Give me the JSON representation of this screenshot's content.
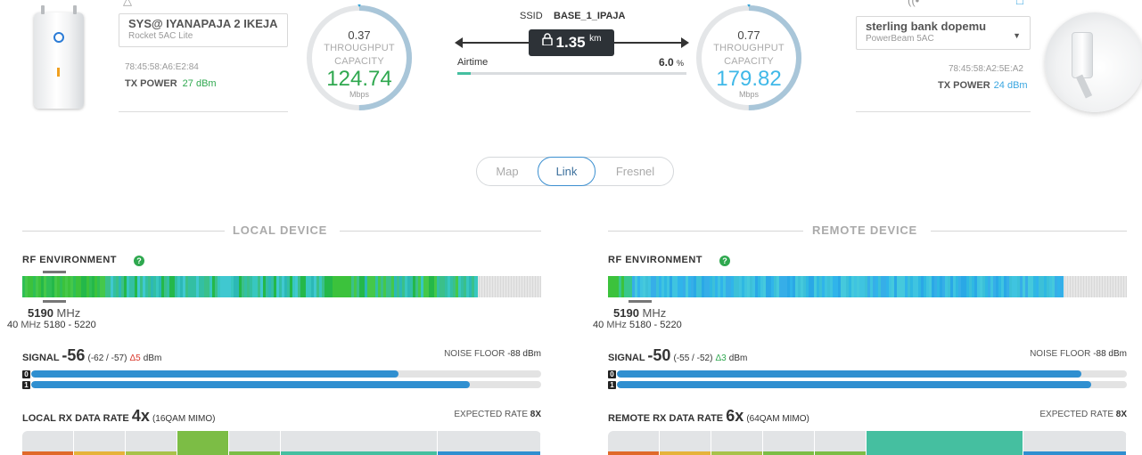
{
  "local": {
    "device_name": "SYS@ IYANAPAJA 2 IKEJA",
    "device_model": "Rocket 5AC Lite",
    "mac": "78:45:58:A6:E2:84",
    "tx_power_label": "TX POWER",
    "tx_power_value": "27 dBm",
    "tx_color": "#2fa84f",
    "gauge": {
      "throughput": "0.37",
      "label_throughput": "THROUGHPUT",
      "label_capacity": "CAPACITY",
      "capacity": "124.74",
      "unit": "Mbps",
      "color": "#2fa84f",
      "fill_fraction": 0.5
    }
  },
  "link": {
    "ssid_label": "SSID",
    "ssid_value": "BASE_1_IPAJA",
    "distance": "1.35",
    "distance_unit": "km",
    "airtime_label": "Airtime",
    "airtime_value": "6.0",
    "airtime_unit": "%",
    "airtime_fraction": 0.06
  },
  "remote": {
    "device_name": "sterling bank dopemu",
    "device_model": "PowerBeam 5AC",
    "mac": "78:45:58:A2:5E:A2",
    "tx_power_label": "TX POWER",
    "tx_power_value": "24 dBm",
    "tx_color": "#3aa6e0",
    "gauge": {
      "throughput": "0.77",
      "label_throughput": "THROUGHPUT",
      "label_capacity": "CAPACITY",
      "capacity": "179.82",
      "unit": "Mbps",
      "color": "#3fb8e8",
      "fill_fraction": 0.5
    }
  },
  "tabs": [
    "Map",
    "Link",
    "Fresnel"
  ],
  "active_tab": "Link",
  "panels": {
    "local": {
      "title": "LOCAL DEVICE",
      "rf_title": "RF ENVIRONMENT",
      "freq": "5190",
      "freq_unit": "MHz",
      "width": "40",
      "width_unit": "MHz",
      "range": "5180 - 5220",
      "spectrum_fill_fraction": 0.878,
      "spectrum_palette": "green",
      "signal_label": "SIGNAL",
      "signal_value": "-56",
      "signal_chains": "(-62 / -57)",
      "signal_delta": "Δ5",
      "signal_delta_color": "red",
      "signal_unit": "dBm",
      "noise_label": "NOISE FLOOR",
      "noise_value": "-88 dBm",
      "chain_labels": [
        "0",
        "1"
      ],
      "chain_fractions": [
        0.72,
        0.86
      ],
      "rate_label": "LOCAL RX DATA RATE",
      "rate_value": "4x",
      "rate_detail": "(16QAM MIMO)",
      "expected_label": "EXPECTED RATE",
      "expected_value": "8X",
      "rate_active_index": 3,
      "rate_active_color": "#7cbd45"
    },
    "remote": {
      "title": "REMOTE DEVICE",
      "rf_title": "RF ENVIRONMENT",
      "freq": "5190",
      "freq_unit": "MHz",
      "width": "40",
      "width_unit": "MHz",
      "range": "5180 - 5220",
      "spectrum_fill_fraction": 0.878,
      "spectrum_palette": "blue",
      "signal_label": "SIGNAL",
      "signal_value": "-50",
      "signal_chains": "(-55 / -52)",
      "signal_delta": "Δ3",
      "signal_delta_color": "green",
      "signal_unit": "dBm",
      "noise_label": "NOISE FLOOR",
      "noise_value": "-88 dBm",
      "chain_labels": [
        "0",
        "1"
      ],
      "chain_fractions": [
        0.91,
        0.93
      ],
      "rate_label": "REMOTE RX DATA RATE",
      "rate_value": "6x",
      "rate_detail": "(64QAM MIMO)",
      "expected_label": "EXPECTED RATE",
      "expected_value": "8X",
      "rate_active_index": 5,
      "rate_active_color": "#45bfa0"
    }
  }
}
